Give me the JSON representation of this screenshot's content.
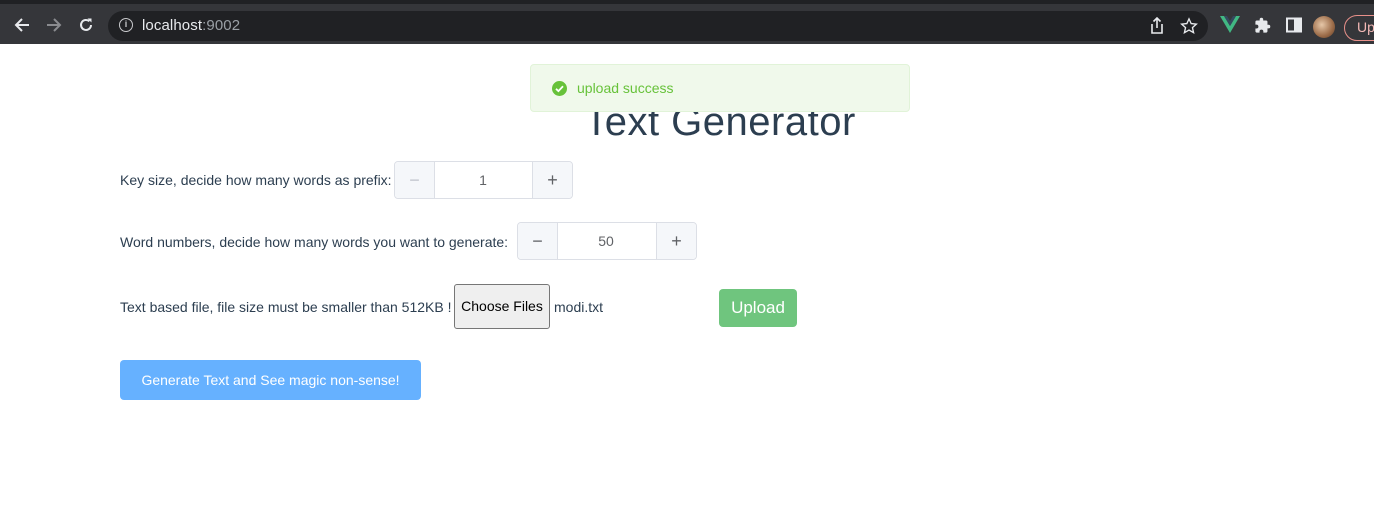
{
  "browser": {
    "url_host": "localhost",
    "url_port": ":9002",
    "update_label": "Up",
    "icons": [
      "back-arrow-icon",
      "forward-arrow-icon",
      "reload-icon",
      "info-icon",
      "share-icon",
      "star-icon",
      "vue-devtools-icon",
      "puzzle-extensions-icon",
      "sidepanel-icon",
      "profile-avatar"
    ]
  },
  "toast": {
    "message": "upload success",
    "color": "#67c23a",
    "background": "#f0f9eb"
  },
  "page": {
    "title": "Text Generator",
    "title_color": "#2c3e50"
  },
  "key_size": {
    "label": "Key size, decide how many words as prefix:",
    "value": "1",
    "minus": "−",
    "plus": "+"
  },
  "word_numbers": {
    "label": "Word numbers, decide how many words you want to generate:",
    "value": "50",
    "minus": "−",
    "plus": "+"
  },
  "file_upload": {
    "label": "Text based file, file size must be smaller than 512KB !",
    "choose_label": "Choose Files",
    "file_name": "modi.txt",
    "upload_label": "Upload",
    "upload_color": "#6fc57e"
  },
  "generate": {
    "label": "Generate Text and See magic non-sense!",
    "color": "#66b1ff"
  }
}
